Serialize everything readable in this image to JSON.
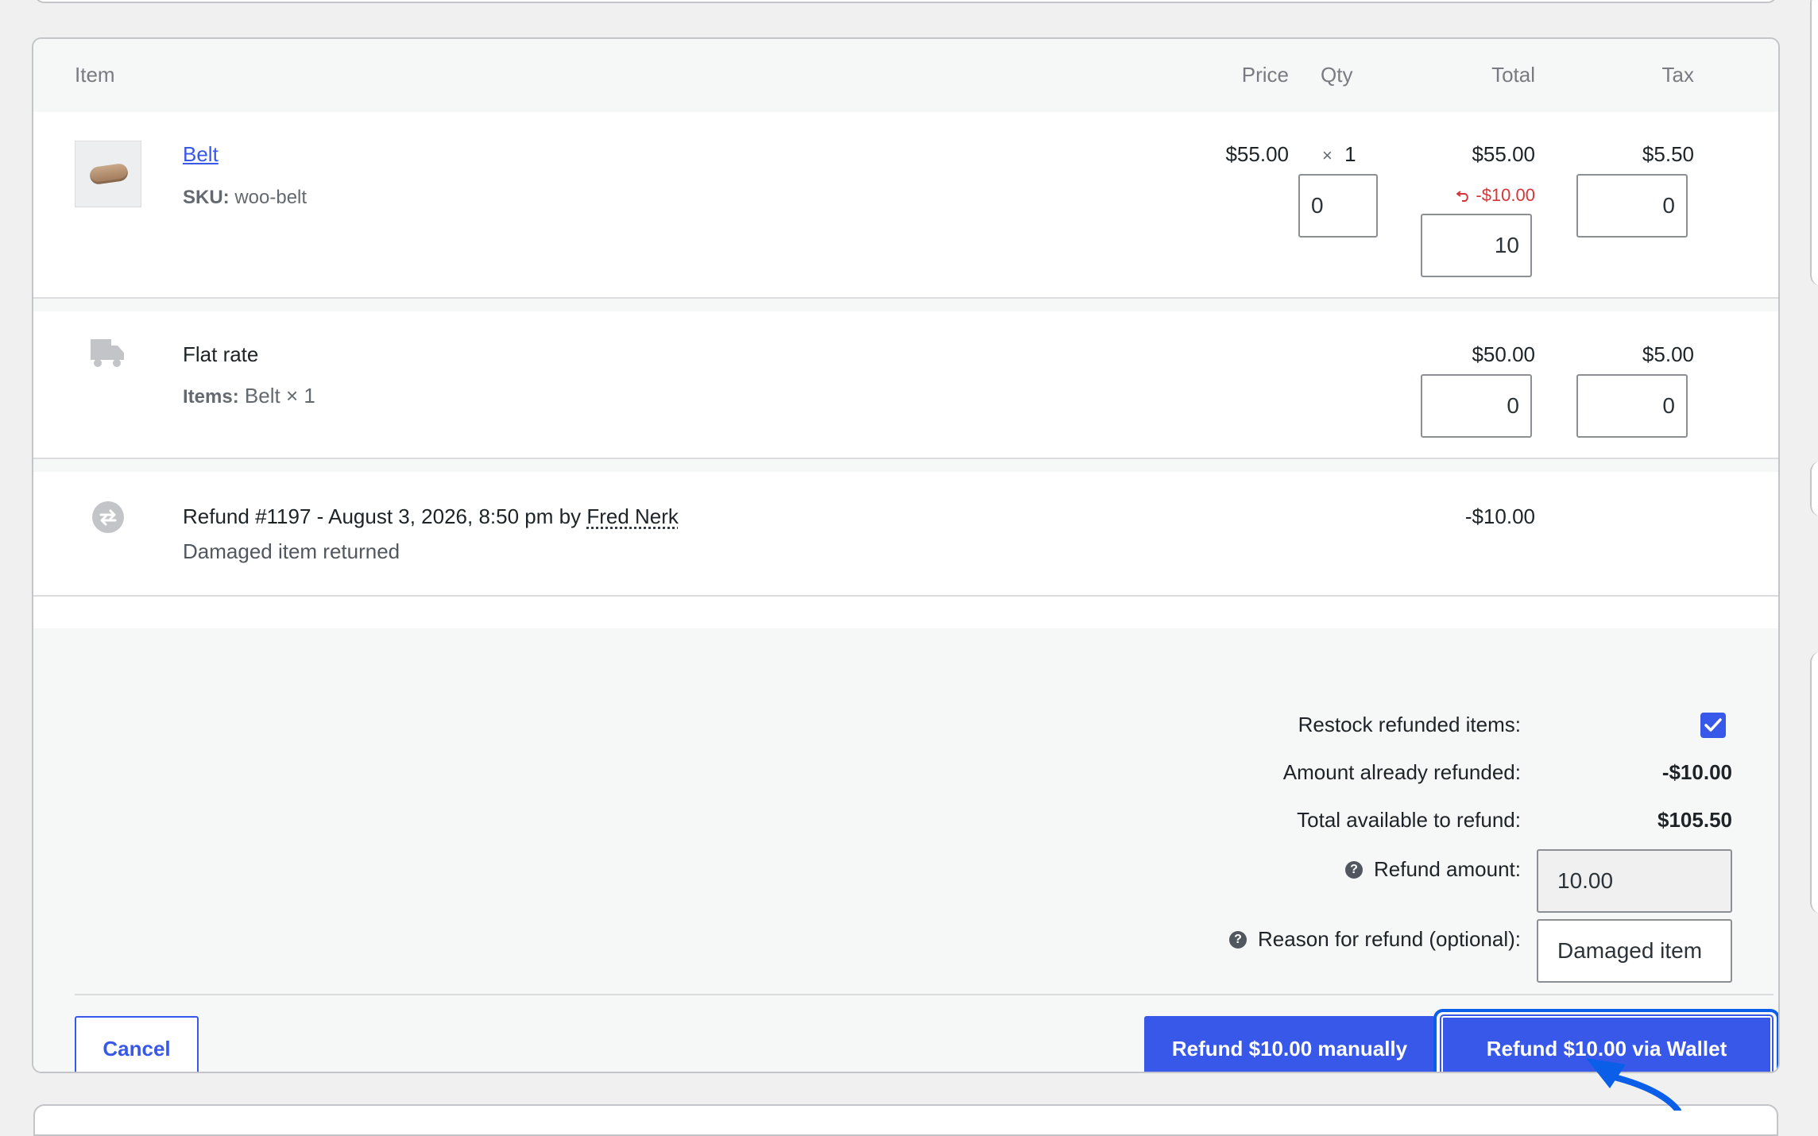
{
  "columns": {
    "item": "Item",
    "price": "Price",
    "qty": "Qty",
    "total": "Total",
    "tax": "Tax"
  },
  "line_item": {
    "name": "Belt",
    "sku_label": "SKU:",
    "sku_value": "woo-belt",
    "price": "$55.00",
    "qty_prefix": "×",
    "qty": "1",
    "total": "$55.00",
    "refunded": "-$10.00",
    "tax": "$5.50",
    "refund_qty_input": "0",
    "refund_total_input": "10",
    "refund_tax_input": "0"
  },
  "shipping": {
    "name": "Flat rate",
    "items_label": "Items:",
    "items_value": "Belt × 1",
    "total": "$50.00",
    "tax": "$5.00",
    "refund_total_input": "0",
    "refund_tax_input": "0"
  },
  "refund_entry": {
    "title_prefix": "Refund #1197 - August 3, 2026, 8:50 pm by",
    "author": "Fred Nerk",
    "reason": "Damaged item returned",
    "amount": "-$10.00"
  },
  "refund_panel": {
    "restock_label": "Restock refunded items:",
    "restock_checked": true,
    "already_refunded_label": "Amount already refunded:",
    "already_refunded_value": "-$10.00",
    "available_label": "Total available to refund:",
    "available_value": "$105.50",
    "amount_label": "Refund amount:",
    "amount_value": "10.00",
    "reason_label": "Reason for refund (optional):",
    "reason_value": "Damaged item"
  },
  "buttons": {
    "cancel": "Cancel",
    "refund_manual": "Refund $10.00 manually",
    "refund_wallet": "Refund $10.00 via Wallet"
  },
  "colors": {
    "accent": "#3858e9",
    "refund_red": "#d63638",
    "highlight_outline": "#0a5ee8"
  },
  "icons": {
    "shipping": "truck-icon",
    "refund": "refund-arrows-icon",
    "refunded_marker": "undo-arrow-icon",
    "help": "help-icon",
    "annotation": "arrow-icon"
  }
}
